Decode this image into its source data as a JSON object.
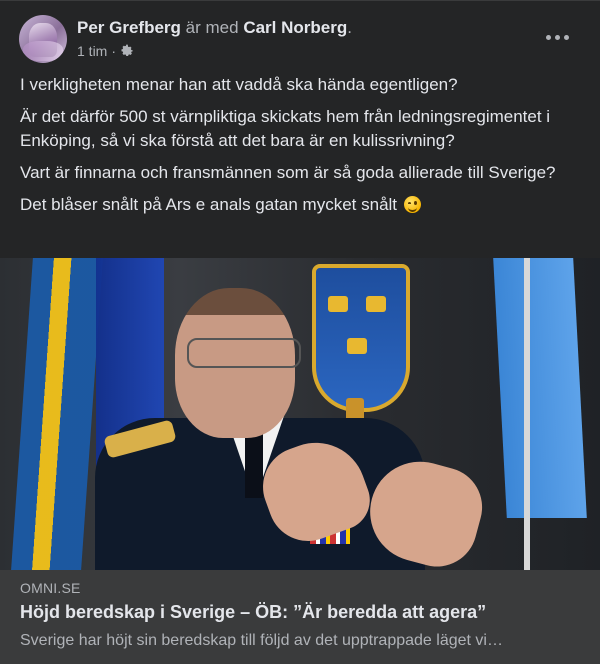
{
  "post": {
    "author": "Per Grefberg",
    "with_text": "är med",
    "tagged": "Carl Norberg",
    "time": "1 tim",
    "separator": "·",
    "privacy_icon": "gear-icon",
    "more_icon": "more-options-icon"
  },
  "body": {
    "p1": "I verkligheten menar han att vaddå ska hända egentligen?",
    "p2": "Är det därför 500 st värnpliktiga skickats hem från ledningsregimentet i Enköping,  så vi ska förstå att det bara är en kulissrivning?",
    "p3": "Vart är finnarna och fransmännen som är så goda allierade till Sverige?",
    "p4": "Det blåser snålt på Ars e anals gatan mycket snålt",
    "emoji": "winking-face-emoji"
  },
  "link": {
    "domain": "OMNI.SE",
    "title": "Höjd beredskap i Sverige – ÖB: ”Är beredda att agera”",
    "description": "Sverige har höjt sin beredskap till följd av det upptrappade läget vi…"
  },
  "colors": {
    "background": "#242526",
    "text": "#e4e6eb",
    "secondary": "#b0b3b8",
    "link_card": "#3a3b3c"
  }
}
